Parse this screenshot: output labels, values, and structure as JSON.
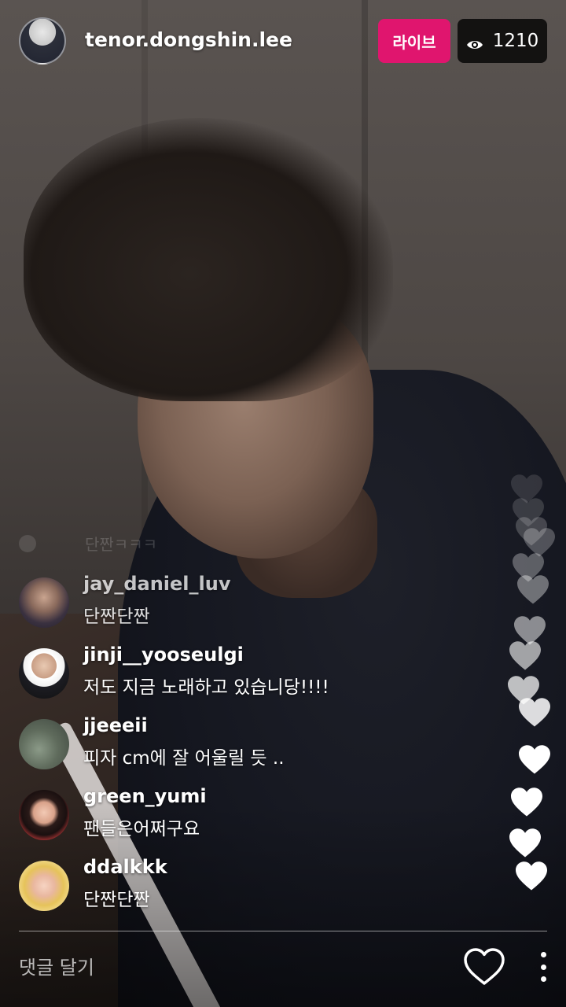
{
  "header": {
    "host_username": "tenor.dongshin.lee",
    "live_label": "라이브",
    "viewer_count": "1210",
    "live_color": "#e0156e"
  },
  "faded_comment": {
    "text": "단짠ㅋㅋㅋ"
  },
  "comments": [
    {
      "username": "jay_daniel_luv",
      "text": "단짠단짠"
    },
    {
      "username": "jinji__yooseulgi",
      "text": "저도 지금 노래하고 있습니당!!!!"
    },
    {
      "username": "jjeeeii",
      "text": "피자 cm에 잘 어울릴 듯 .."
    },
    {
      "username": "green_yumi",
      "text": "팬들은어쩌구요"
    },
    {
      "username": "ddalkkk",
      "text": "단짠단짠"
    }
  ],
  "footer": {
    "comment_placeholder": "댓글 달기"
  },
  "icons": {
    "viewer": "eye-icon",
    "like": "heart-outline-icon",
    "more": "more-vertical-icon",
    "floating": "heart-icon"
  }
}
